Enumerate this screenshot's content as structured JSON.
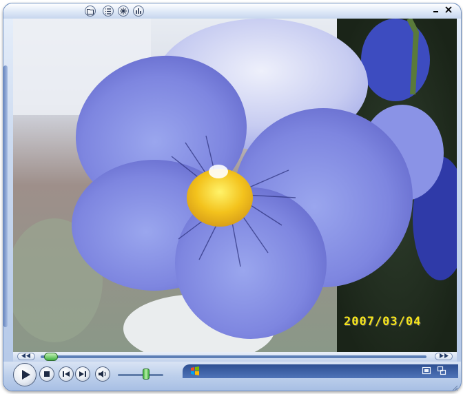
{
  "video": {
    "date_stamp": "2007/03/04"
  },
  "icons": {
    "folder": "folder-icon",
    "playlist": "playlist-icon",
    "visualization": "visualization-icon",
    "equalizer": "equalizer-icon",
    "minimize": "minimize-icon",
    "fullscreen": "fullscreen-icon",
    "switch_mode": "switch-mode-icon",
    "windows_logo": "windows-logo-icon"
  },
  "colors": {
    "date_stamp": "#f5e51a",
    "seek_thumb": "#3fb03f",
    "skin": "#c9d8ef"
  },
  "playback": {
    "progress": 0.01,
    "volume": 0.65
  }
}
